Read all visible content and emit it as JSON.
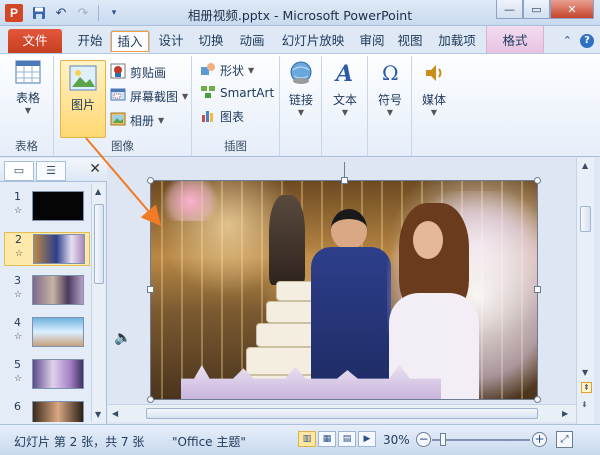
{
  "window": {
    "title": "相册视频.pptx - Microsoft PowerPoint",
    "app_icon_letter": "P"
  },
  "tabs": {
    "file": "文件",
    "items": [
      "开始",
      "插入",
      "设计",
      "切换",
      "动画",
      "幻灯片放映",
      "审阅",
      "视图",
      "加载项"
    ],
    "active": "插入",
    "contextual": "格式"
  },
  "ribbon": {
    "groups": {
      "tables": {
        "label": "表格",
        "table_button": "表格"
      },
      "images": {
        "label": "图像",
        "picture_button": "图片",
        "clipart": "剪贴画",
        "screenshot": "屏幕截图",
        "album": "相册"
      },
      "illustrations": {
        "label": "插图",
        "shapes": "形状",
        "smartart": "SmartArt",
        "chart": "图表"
      },
      "links": {
        "label": "链接"
      },
      "text": {
        "label": "文本"
      },
      "symbols": {
        "label": "符号"
      },
      "media": {
        "label": "媒体"
      }
    }
  },
  "thumbnails": {
    "slides": [
      {
        "number": "1",
        "star": "☆"
      },
      {
        "number": "2",
        "star": "☆"
      },
      {
        "number": "3",
        "star": "☆"
      },
      {
        "number": "4",
        "star": "☆"
      },
      {
        "number": "5",
        "star": "☆"
      },
      {
        "number": "6",
        "star": "☆"
      }
    ],
    "selected_index": 1
  },
  "statusbar": {
    "slide_info": "幻灯片 第 2 张，共 7 张",
    "theme": "\"Office 主题\"",
    "zoom": "30%",
    "zoom_fraction": 0.3
  },
  "colors": {
    "file_tab": "#d24625",
    "accent_arrow": "#f07a25",
    "selection_fill": "#ffd873"
  }
}
